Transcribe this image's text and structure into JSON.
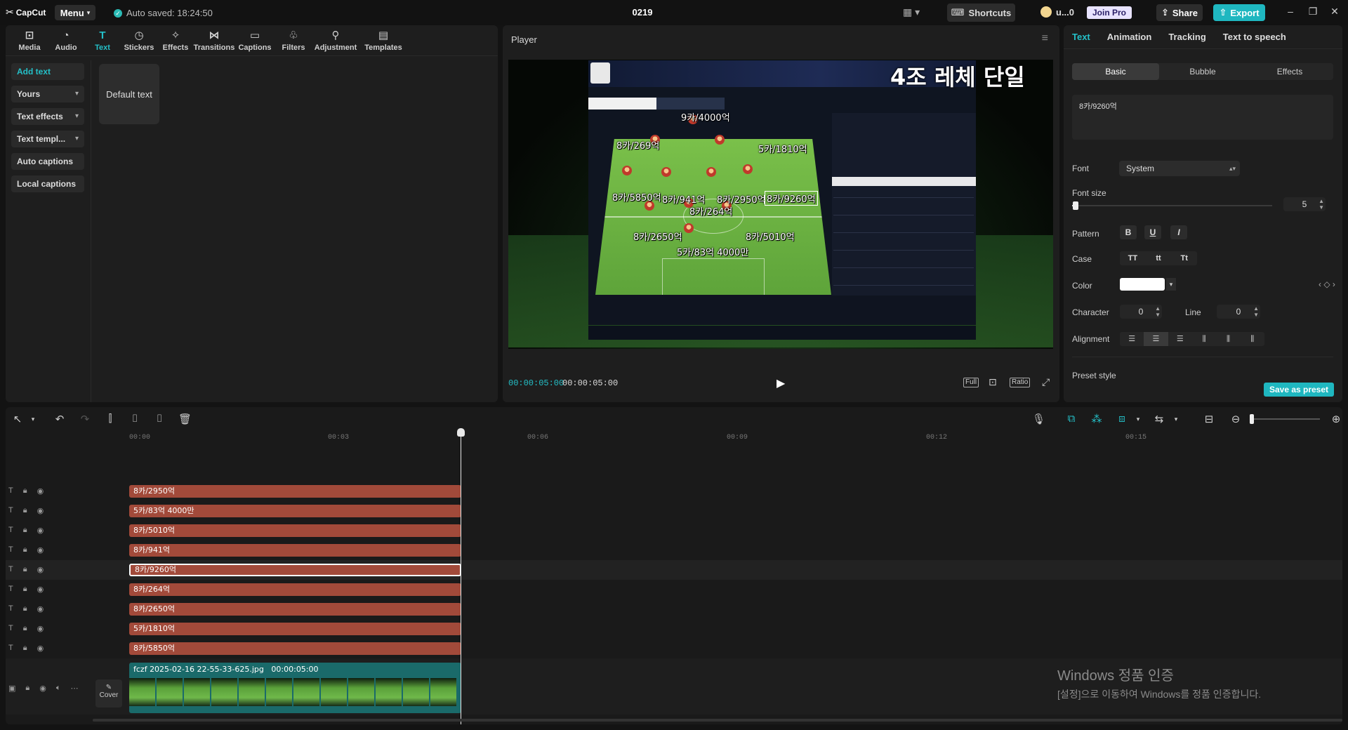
{
  "app": {
    "logo": "CapCut",
    "menu_label": "Menu",
    "autosave": "Auto saved: 18:24:50",
    "project_title": "0219",
    "shortcuts_label": "Shortcuts",
    "user_name": "u...0",
    "join_pro_label": "Join Pro",
    "share_label": "Share",
    "export_label": "Export"
  },
  "toolbar": {
    "tools": [
      {
        "label": "Media",
        "icon": "media-icon"
      },
      {
        "label": "Audio",
        "icon": "audio-icon"
      },
      {
        "label": "Text",
        "icon": "text-icon"
      },
      {
        "label": "Stickers",
        "icon": "stickers-icon"
      },
      {
        "label": "Effects",
        "icon": "effects-icon"
      },
      {
        "label": "Transitions",
        "icon": "transitions-icon"
      },
      {
        "label": "Captions",
        "icon": "captions-icon"
      },
      {
        "label": "Filters",
        "icon": "filters-icon"
      },
      {
        "label": "Adjustment",
        "icon": "adjustment-icon"
      },
      {
        "label": "Templates",
        "icon": "templates-icon"
      }
    ]
  },
  "text_panel": {
    "subnav": [
      "Add text",
      "Yours",
      "Text effects",
      "Text templ...",
      "Auto captions",
      "Local captions"
    ],
    "default_text": "Default text"
  },
  "player": {
    "title": "Player",
    "overlay_title": "4조 레체 단일",
    "overlays": [
      "9카/4000억",
      "8카/269억",
      "5카/1810억",
      "8카/5850억",
      "8카/941억",
      "8카/2950억",
      "8카/9260억",
      "8카/264억",
      "8카/2650억",
      "8카/5010억",
      "5카/83억 4000만"
    ],
    "current_time": "00:00:05:00",
    "duration": "00:00:05:00",
    "btn_full": "Full",
    "btn_ratio": "Ratio"
  },
  "properties": {
    "tabs": [
      "Text",
      "Animation",
      "Tracking",
      "Text to speech"
    ],
    "segments": [
      "Basic",
      "Bubble",
      "Effects"
    ],
    "text_value": "8카/9260억",
    "font_label": "Font",
    "font_value": "System",
    "font_size_label": "Font size",
    "font_size_value": "5",
    "font_size_fraction": 0.01,
    "pattern_label": "Pattern",
    "case_label": "Case",
    "case_options": [
      "TT",
      "tt",
      "Tt"
    ],
    "color_label": "Color",
    "text_color": "#ffffff",
    "character_label": "Character",
    "character_value": "0",
    "line_label": "Line",
    "line_value": "0",
    "alignment_label": "Alignment",
    "preset_style_label": "Preset style",
    "save_preset_label": "Save as preset"
  },
  "timeline": {
    "ruler": [
      "00:00",
      "00:03",
      "00:06",
      "00:09",
      "00:12",
      "00:15"
    ],
    "text_clips": [
      "8카/2950억",
      "5카/83억 4000만",
      "8카/5010억",
      "8카/941억",
      "8카/9260억",
      "8카/264억",
      "8카/2650억",
      "5카/1810억",
      "8카/5850억"
    ],
    "selected_clip_index": 4,
    "video_clip_name": "fczf 2025-02-16 22-55-33-625.jpg",
    "video_clip_duration": "00:00:05:00",
    "cover_label": "Cover"
  },
  "watermark": {
    "line1": "Windows 정품 인증",
    "line2": "[설정]으로 이동하여 Windows를 정품 인증합니다."
  },
  "colors": {
    "accent": "#24c0c8",
    "text_clip": "#a24a3a",
    "video_clip": "#1a6a6a"
  }
}
